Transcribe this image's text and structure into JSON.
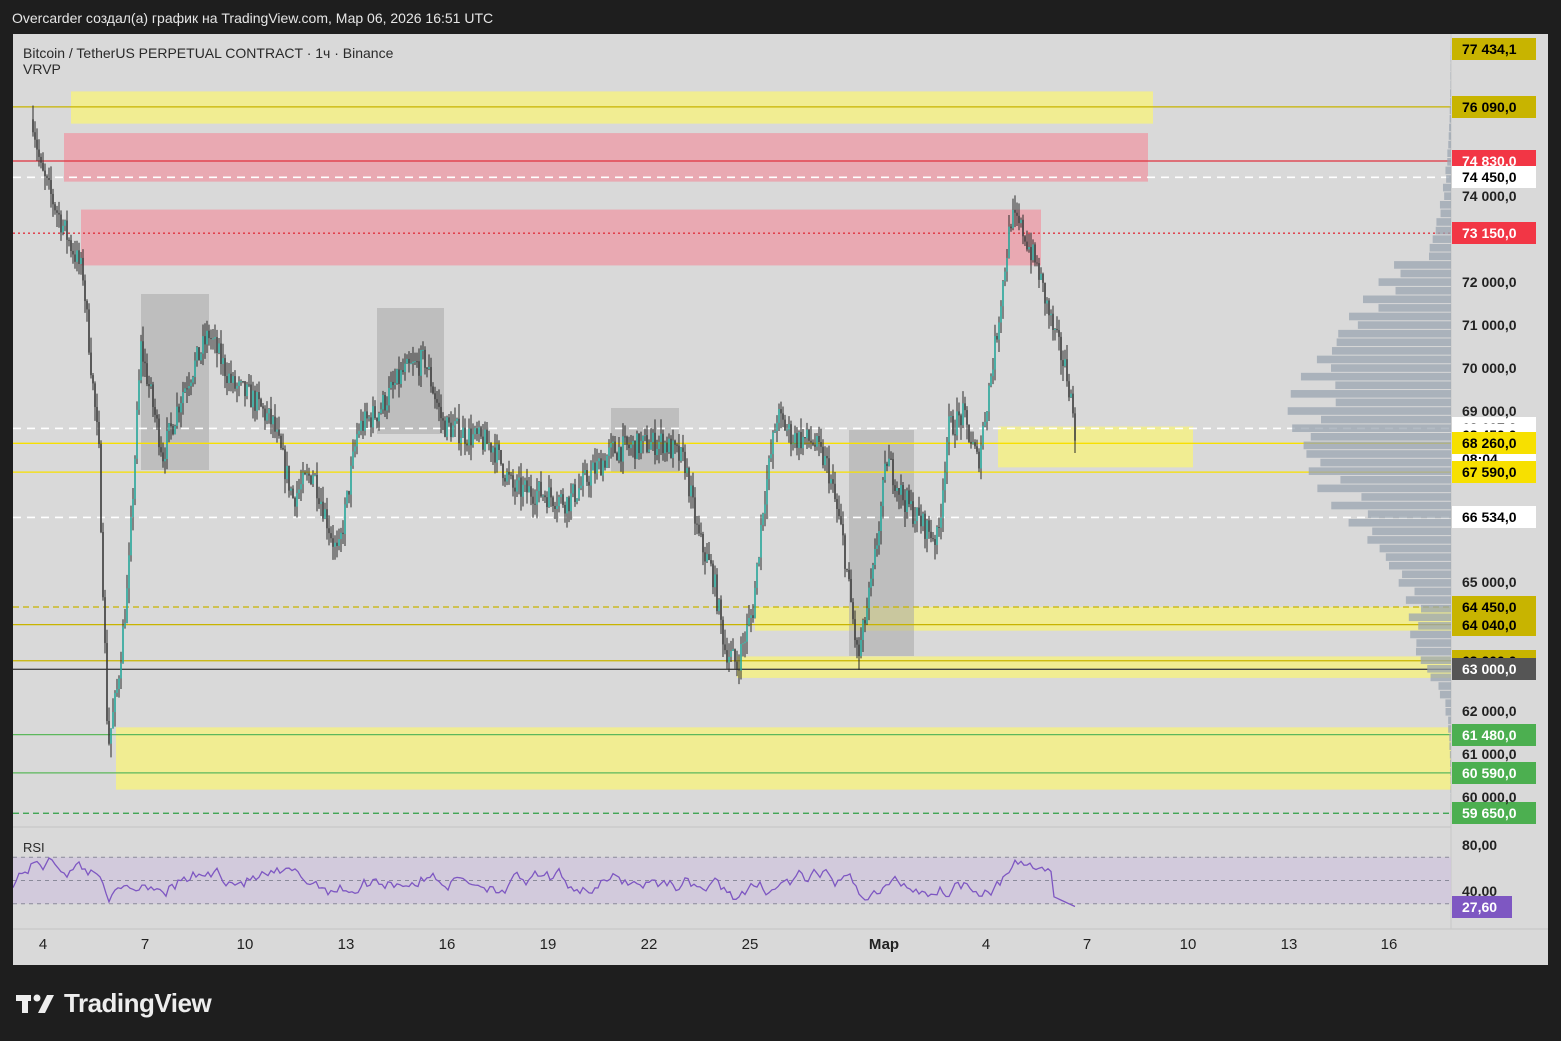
{
  "header": {
    "text": "Overcarder создал(а) график на TradingView.com, Мар 06, 2026 16:51 UTC"
  },
  "legend": {
    "symbol": "Bitcoin / TetherUS PERPETUAL CONTRACT · 1ч · Binance",
    "indicator": "VRVP"
  },
  "rsi": {
    "title": "RSI",
    "value": "27,60"
  },
  "price_labels": [
    {
      "text": "77 434,1",
      "bg": "#c8b400",
      "fg": "#000000"
    },
    {
      "text": "76 090,0",
      "bg": "#c8b400",
      "fg": "#000000"
    },
    {
      "text": "74 830,0",
      "bg": "#f23645",
      "fg": "#ffffff"
    },
    {
      "text": "74 450,0",
      "bg": "#ffffff",
      "fg": "#000000"
    },
    {
      "text": "73 150,0",
      "bg": "#f23645",
      "fg": "#ffffff"
    },
    {
      "text": "68 607,2",
      "bg": "#ffffff",
      "fg": "#000000"
    },
    {
      "text": "08:04",
      "bg": "#ffffff",
      "fg": "#000000"
    },
    {
      "text": "68 450,0",
      "bg": "#ffffff",
      "fg": "#000000"
    },
    {
      "text": "68 260,0",
      "bg": "#f7e000",
      "fg": "#000000"
    },
    {
      "text": "67 590,0",
      "bg": "#f7e000",
      "fg": "#000000"
    },
    {
      "text": "66 534,0",
      "bg": "#ffffff",
      "fg": "#000000"
    },
    {
      "text": "64 450,0",
      "bg": "#c8b400",
      "fg": "#000000"
    },
    {
      "text": "64 040,0",
      "bg": "#c8b400",
      "fg": "#000000"
    },
    {
      "text": "63 200,0",
      "bg": "#c8b400",
      "fg": "#000000"
    },
    {
      "text": "63 000,0",
      "bg": "#555555",
      "fg": "#ffffff"
    },
    {
      "text": "61 480,0",
      "bg": "#4caf50",
      "fg": "#ffffff"
    },
    {
      "text": "60 590,0",
      "bg": "#4caf50",
      "fg": "#ffffff"
    },
    {
      "text": "59 650,0",
      "bg": "#4caf50",
      "fg": "#ffffff"
    }
  ],
  "axis_labels": [
    "74 000,0",
    "72 000,0",
    "71 000,0",
    "70 000,0",
    "69 000,0",
    "65 000,0",
    "62 000,0",
    "61 000,0",
    "60 000,0"
  ],
  "rsi_axis_labels": [
    "80,00",
    "40,00"
  ],
  "time_labels": [
    "4",
    "7",
    "10",
    "13",
    "16",
    "19",
    "22",
    "25",
    "Мар",
    "4",
    "7",
    "10",
    "13",
    "16"
  ],
  "footer": {
    "brand": "TradingView"
  },
  "chart_data": {
    "type": "candlestick",
    "symbol": "BTCUSDT.P",
    "timeframe": "1h",
    "exchange": "Binance",
    "last_price": 68607.2,
    "countdown": "08:04",
    "ylim": [
      59400,
      77600
    ],
    "series": [
      {
        "name": "Bitcoin / TetherUS PERPETUAL CONTRACT",
        "x": [
          "4",
          "5",
          "6",
          "7",
          "9",
          "11",
          "14",
          "16",
          "18",
          "21",
          "24",
          "25",
          "27",
          "Мар",
          "3",
          "4",
          "5",
          "6"
        ],
        "close": [
          75800,
          71800,
          61000,
          70500,
          70800,
          69200,
          69700,
          68700,
          67000,
          68700,
          63300,
          68500,
          66400,
          64000,
          68200,
          73800,
          71000,
          68600
        ]
      }
    ],
    "zones": [
      {
        "name": "76 090,0",
        "from": 75700,
        "to": 76450,
        "color": "#f3ee8a"
      },
      {
        "name": "74 830,0",
        "from": 74350,
        "to": 75480,
        "color": "#eaa3ad"
      },
      {
        "name": "73 150,0",
        "from": 72400,
        "to": 73700,
        "color": "#eaa3ad"
      },
      {
        "name": "68 450,0",
        "from": 67700,
        "to": 68650,
        "color": "#f3ee8a"
      },
      {
        "name": "64 040,0",
        "from": 63900,
        "to": 64450,
        "color": "#f3ee8a"
      },
      {
        "name": "63 200,0",
        "from": 62800,
        "to": 63300,
        "color": "#f3ee8a"
      },
      {
        "name": "61 480,0",
        "from": 60200,
        "to": 61650,
        "color": "#f3ee8a"
      }
    ],
    "rsi": {
      "current": 27.6,
      "levels": [
        70,
        50,
        30
      ],
      "ylim": [
        10,
        90
      ]
    }
  }
}
